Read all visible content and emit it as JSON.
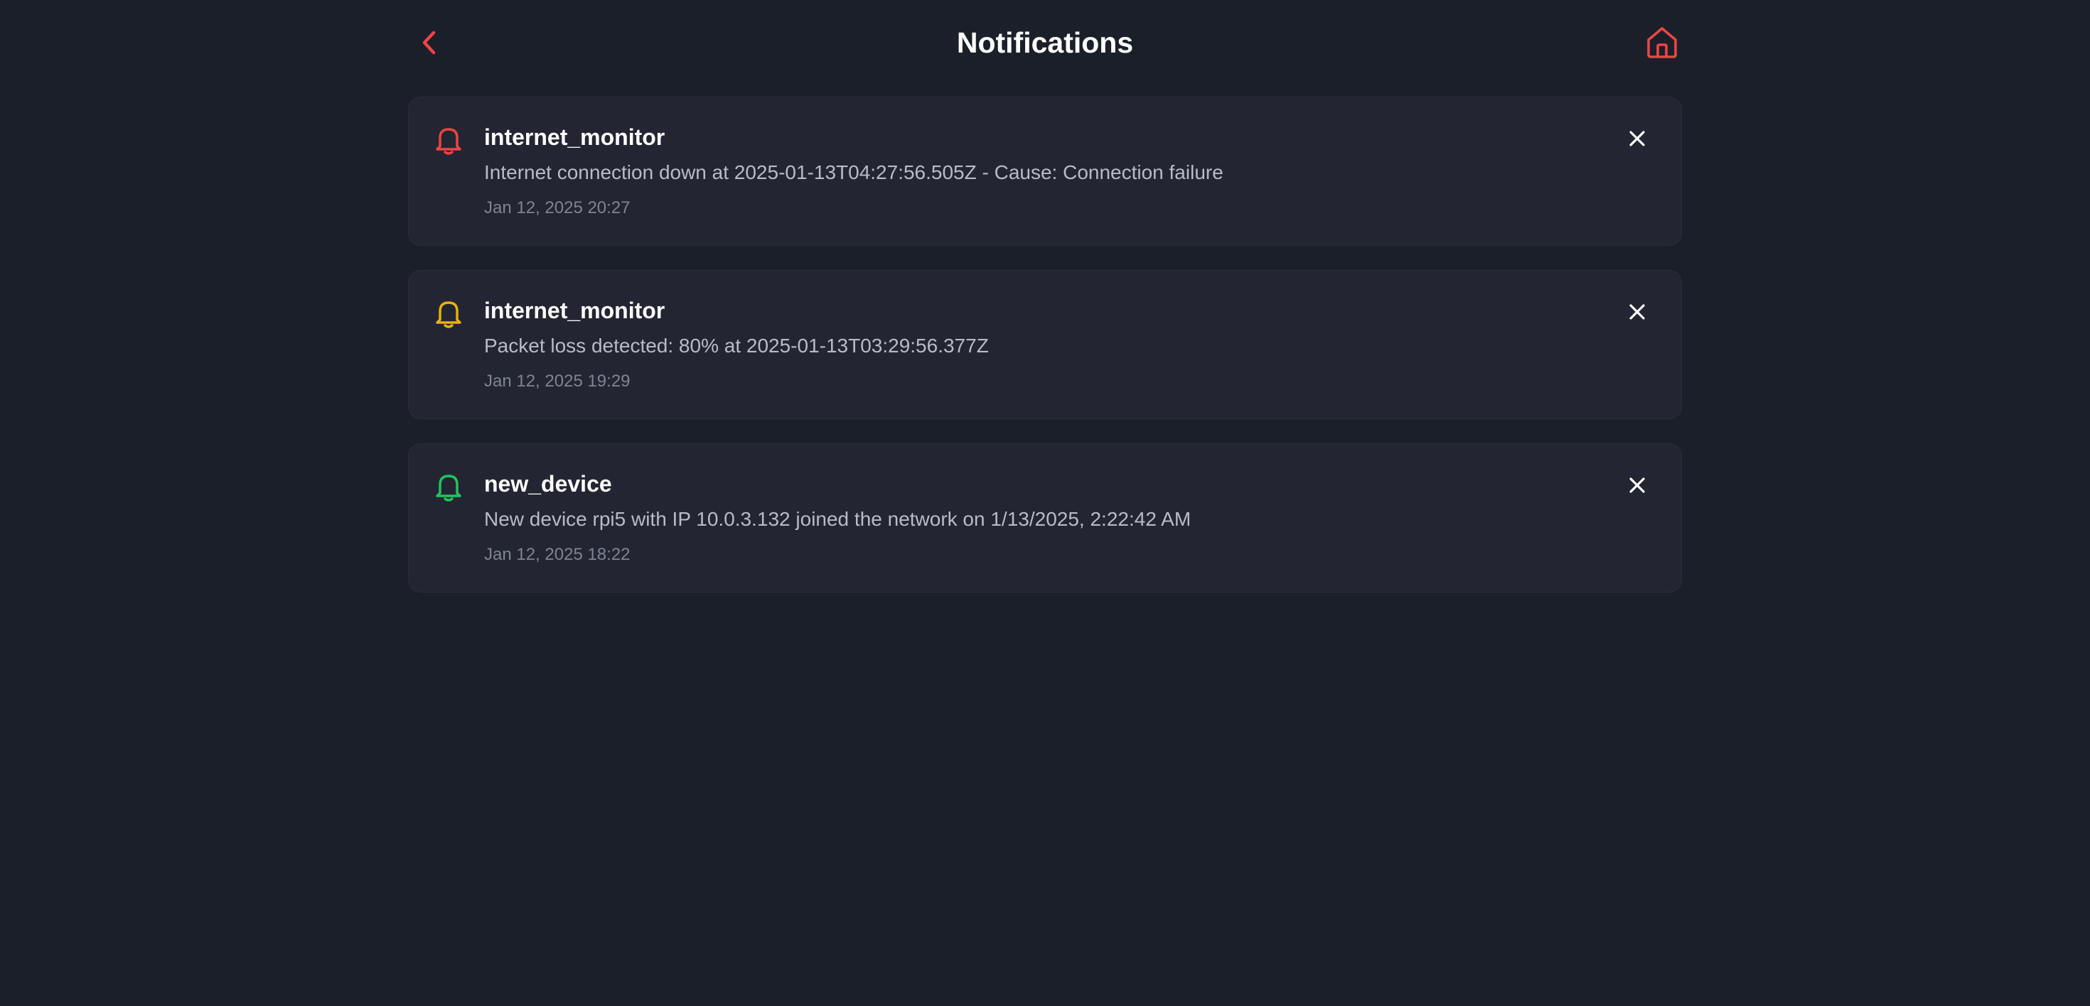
{
  "header": {
    "title": "Notifications",
    "back_icon": "chevron-left-icon",
    "home_icon": "home-icon",
    "accent_color": "#ef4444"
  },
  "notifications": [
    {
      "source": "internet_monitor",
      "message": "Internet connection down at 2025-01-13T04:27:56.505Z - Cause: Connection failure",
      "time": "Jan 12, 2025 20:27",
      "icon": "bell-icon",
      "severity_color": "#ef4444"
    },
    {
      "source": "internet_monitor",
      "message": "Packet loss detected: 80% at 2025-01-13T03:29:56.377Z",
      "time": "Jan 12, 2025 19:29",
      "icon": "bell-icon",
      "severity_color": "#eab308"
    },
    {
      "source": "new_device",
      "message": "New device rpi5 with IP 10.0.3.132 joined the network on 1/13/2025, 2:22:42 AM",
      "time": "Jan 12, 2025 18:22",
      "icon": "bell-icon",
      "severity_color": "#22c55e"
    }
  ],
  "close_icon": "close-icon"
}
